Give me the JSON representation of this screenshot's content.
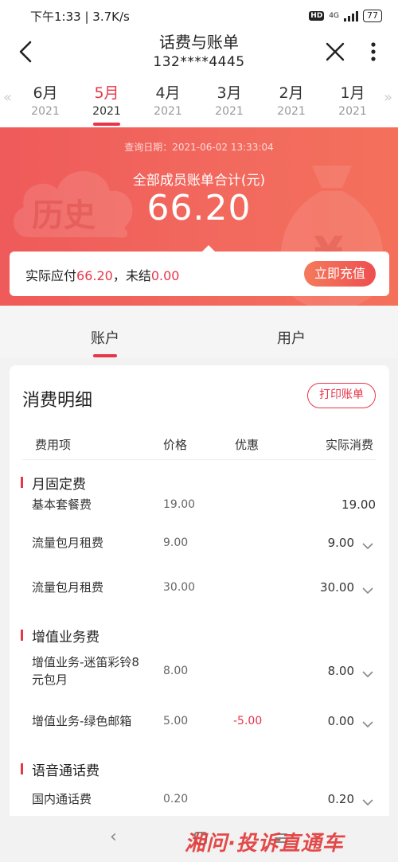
{
  "status": {
    "left": "下午1:33 | 3.7K/s",
    "hd": "HD",
    "network": "4G",
    "battery": "77"
  },
  "header": {
    "title": "话费与账单",
    "phone": "132****4445"
  },
  "months": [
    {
      "month": "6月",
      "year": "2021"
    },
    {
      "month": "5月",
      "year": "2021"
    },
    {
      "month": "4月",
      "year": "2021"
    },
    {
      "month": "3月",
      "year": "2021"
    },
    {
      "month": "2月",
      "year": "2021"
    },
    {
      "month": "1月",
      "year": "2021"
    }
  ],
  "banner": {
    "query_date": "查询日期：2021-06-02 13:33:04",
    "total_label": "全部成员账单合计(元)",
    "total_amount": "66.20",
    "history_text": "历史",
    "pay_prefix": "实际应付",
    "pay_amount": "66.20",
    "unsettled_prefix": "，未结",
    "unsettled_amount": "0.00",
    "recharge_label": "立即充值"
  },
  "tabs": {
    "account": "账户",
    "user": "用户"
  },
  "detail": {
    "title": "消费明细",
    "print_label": "打印账单",
    "columns": {
      "item": "费用项",
      "price": "价格",
      "discount": "优惠",
      "actual": "实际消费"
    },
    "sections": {
      "monthly": "月固定费",
      "value_added": "增值业务费",
      "voice": "语音通话费"
    },
    "rows": [
      {
        "name": "基本套餐费",
        "price": "19.00",
        "discount": "",
        "actual": "19.00"
      },
      {
        "name": "流量包月租费",
        "price": "9.00",
        "discount": "",
        "actual": "9.00"
      },
      {
        "name": "流量包月租费",
        "price": "30.00",
        "discount": "",
        "actual": "30.00"
      },
      {
        "name_line1": "增值业务-迷笛彩铃8",
        "name_line2": "元包月",
        "price": "8.00",
        "discount": "",
        "actual": "8.00"
      },
      {
        "name": "增值业务-绿色邮箱",
        "price": "5.00",
        "discount": "-5.00",
        "actual": "0.00"
      },
      {
        "name": "国内通话费",
        "price": "0.20",
        "discount": "",
        "actual": "0.20"
      }
    ]
  },
  "watermark": "湘问·投诉直通车",
  "colors": {
    "accent": "#e8354a",
    "banner_start": "#ef5a5a",
    "banner_end": "#f4705b"
  }
}
